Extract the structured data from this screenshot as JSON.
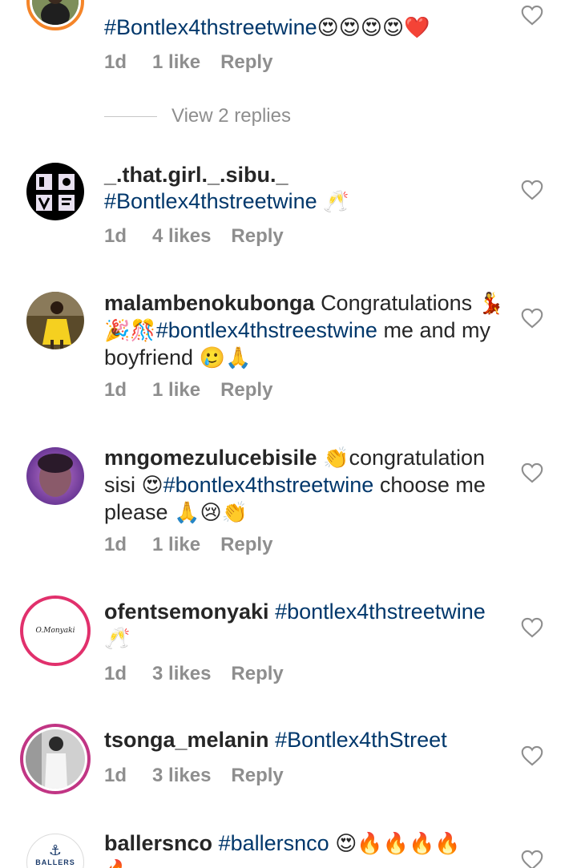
{
  "comments": [
    {
      "username": "",
      "hashtag": "#Bontlex4thstreetwine",
      "text": "",
      "emoji": "😍😍😍😍❤️",
      "time": "1d",
      "likes": "1 like",
      "reply": "Reply"
    },
    {
      "username": "_.that.girl._.sibu._",
      "hashtag": "#Bontlex4thstreetwine",
      "text": "",
      "emoji": "🥂",
      "time": "1d",
      "likes": "4 likes",
      "reply": "Reply"
    },
    {
      "username": "malambenokubonga",
      "text1": "Congratulations",
      "emoji1": "💃🎉🎊",
      "hashtag": "#bontlex4thstreestwine",
      "text2": "me and my boyfriend",
      "emoji2": "🥲🙏",
      "time": "1d",
      "likes": "1 like",
      "reply": "Reply"
    },
    {
      "username": "mngomezulucebisile",
      "emoji1": "👏",
      "text1": "congratulation sisi",
      "emoji2": "😍",
      "hashtag": "#bontlex4thstreetwine",
      "text2": "choose me please",
      "emoji3": "🙏😢👏",
      "time": "1d",
      "likes": "1 like",
      "reply": "Reply"
    },
    {
      "username": "ofentsemonyaki",
      "hashtag": "#bontlex4thstreetwine",
      "emoji": "🥂",
      "avatar_text": "O.Monyaki",
      "time": "1d",
      "likes": "3 likes",
      "reply": "Reply"
    },
    {
      "username": "tsonga_melanin",
      "hashtag": "#Bontlex4thStreet",
      "time": "1d",
      "likes": "3 likes",
      "reply": "Reply"
    },
    {
      "username": "ballersnco",
      "hashtag": "#ballersnco",
      "emoji": "😍🔥🔥🔥🔥",
      "emoji2": "🔥",
      "avatar_text": "BALLERS"
    }
  ],
  "view_replies": "View 2 replies",
  "colors": {
    "hashtag": "#00376b",
    "meta": "#8e8e8e",
    "ring": "#f58529"
  }
}
